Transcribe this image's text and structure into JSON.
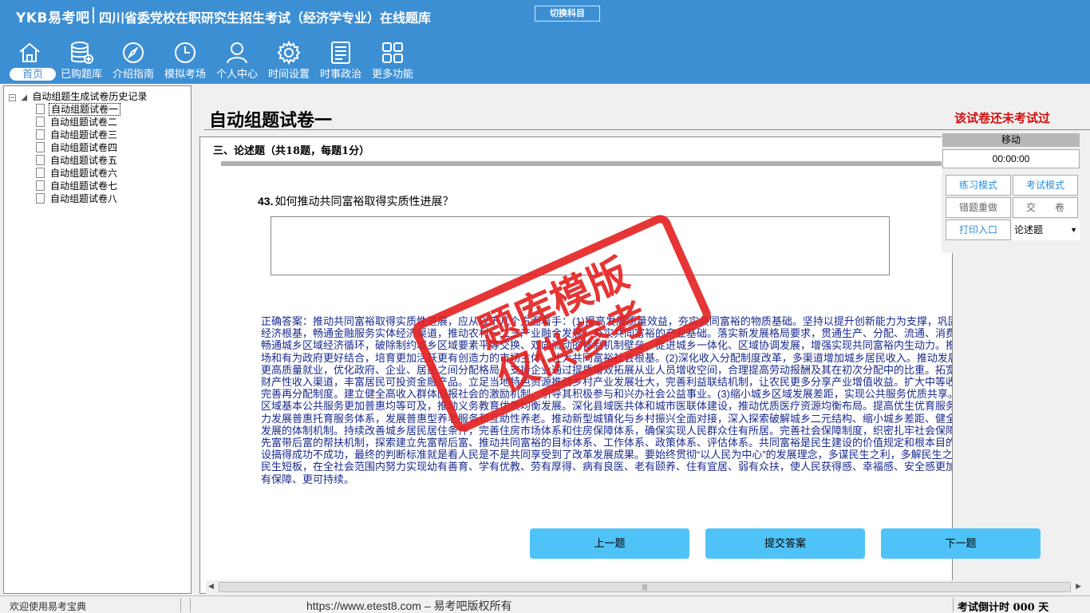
{
  "header": {
    "logo": "YKB易考吧",
    "title": "四川省委党校在职研究生招生考试（经济学专业）在线题库",
    "switch_label": "切换科目"
  },
  "nav": [
    {
      "label": "首页",
      "icon": "home-icon"
    },
    {
      "label": "已购题库",
      "icon": "database-icon"
    },
    {
      "label": "介绍指南",
      "icon": "compass-icon"
    },
    {
      "label": "模拟考场",
      "icon": "clock-icon"
    },
    {
      "label": "个人中心",
      "icon": "user-icon"
    },
    {
      "label": "时间设置",
      "icon": "gear-icon"
    },
    {
      "label": "时事政治",
      "icon": "news-icon"
    },
    {
      "label": "更多功能",
      "icon": "grid-icon"
    }
  ],
  "tree": {
    "root": "自动组题生成试卷历史记录",
    "items": [
      "自动组题试卷一",
      "自动组题试卷二",
      "自动组题试卷三",
      "自动组题试卷四",
      "自动组题试卷五",
      "自动组题试卷六",
      "自动组题试卷七",
      "自动组题试卷八"
    ]
  },
  "paper": {
    "title": "自动组题试卷一",
    "status": "该试卷还未考试过",
    "section": "三、论述题（共18题，每题1分）",
    "question_number": "43.",
    "question": "如何推动共同富裕取得实质性进展？",
    "answer": "正确答案：推动共同富裕取得实质性进展，应从以下几个方面着手：(1)提高发展质量效益，夯实共同富裕的物质基础。坚持以提升创新能力为支撑，巩固壮大实体经济根基，畅通金融服务实体经济渠道，推动农村一二三产业融合发展，夯实共同富裕的产业基础。落实新发展格局要求，贯通生产、分配、流通、消费各环节。畅通城乡区域经济循环，破除制约城乡区域要素平等交换、双向流动的体制机制壁垒，促进城乡一体化、区域协调发展，增强实现共同富裕内生动力。推动有效市场和有为政府更好结合，培育更加活跃更有创造力的市场主体，壮大共同富裕社会根基。(2)深化收入分配制度改革，多渠道增加城乡居民收入。推动发展更加充分更高质量就业，优化政府、企业、居民之间分配格局，支持企业通过提质增效拓展从业人员增收空间，合理提高劳动报酬及其在初次分配中的比重。拓宽城乡居民财产性收入渠道，丰富居民可投资金融产品。立足当地特色资源推动乡村产业发展壮大，完善利益联结机制，让农民更多分享产业增值收益。扩大中等收入群体。完善再分配制度。建立健全高收入群体回报社会的激励机制，引导其积极参与和兴办社会公益事业。(3)缩小城乡区域发展差距，实现公共服务优质共享。推进城乡区域基本公共服务更加普惠均等可及，推动义务教育优质均衡发展。深化县域医共体和城市医联体建设，推动优质医疗资源均衡布局。提高优生优育服务水平，大力发展普惠托育服务体系，发展普惠型养老服务和互助性养老。推动新型城镇化与乡村振兴全面对接，深入探索破解城乡二元结构、缩小城乡差距、健全城乡融合发展的体制机制。持续改善城乡居民居住条件，完善住房市场体系和住房保障体系，确保实现人民群众住有所居。完善社会保障制度，织密扎牢社会保障网，完善先富带后富的帮扶机制，探索建立先富帮后富、推动共同富裕的目标体系、工作体系、政策体系、评估体系。共同富裕是民生建设的价值规定和根本目的。民生建设搞得成功不成功，最终的判断标准就是看人民是不是共同享受到了改革发展成果。要始终贯彻“以人民为中心”的发展理念，多谋民生之利，多解民生之忧，补齐民生短板，在全社会范围内努力实现幼有善育、学有优教、劳有厚得、病有良医、老有颐养、住有宜居、弱有众扶，使人民获得感、幸福感、安全感更加充实、更有保障、更可持续。",
    "prev": "上一题",
    "submit": "提交答案",
    "next": "下一题",
    "watermark_line1": "题库模版",
    "watermark_line2": "仅供参考"
  },
  "side": {
    "move": "移动",
    "timer": "00:00:00",
    "practice_mode": "练习模式",
    "exam_mode": "考试模式",
    "redo_wrong": "错题重做",
    "hand_in": "交　　卷",
    "print": "打印入口",
    "type_selected": "论述题"
  },
  "footer": {
    "welcome": "欢迎使用易考宝典",
    "url": "https://www.etest8.com – 易考吧版权所有",
    "countdown": "考试倒计时 000 天"
  },
  "colors": {
    "header_bg": "#3d8fd4",
    "status_red": "#d01010",
    "answer_blue": "#1a2a8c",
    "button_blue": "#4fc3f7",
    "watermark_red": "#e42020"
  }
}
